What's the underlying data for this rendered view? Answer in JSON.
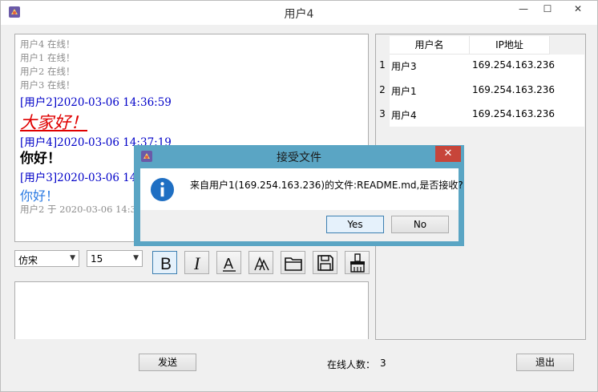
{
  "window": {
    "title": "用户4",
    "minimize_glyph": "—",
    "maximize_glyph": "☐",
    "close_glyph": "✕",
    "icon": "app-icon"
  },
  "chat": {
    "system_lines": [
      "用户4 在线！",
      "用户1 在线！",
      "用户2 在线！",
      "用户3 在线！"
    ],
    "messages": [
      {
        "header": "[用户2]2020-03-06 14:36:59",
        "text": "大家好！"
      },
      {
        "header": "[用户4]2020-03-06 14:37:19",
        "text": "你好！"
      },
      {
        "header": "[用户3]2020-03-06 14:37:34",
        "text": "你好！"
      }
    ],
    "last_line": "用户2 于 2020-03-06 14:38:10"
  },
  "toolbar": {
    "font_family": "仿宋",
    "font_size": "15",
    "icons": [
      "bold-icon",
      "italic-icon",
      "underline-icon",
      "color-icon",
      "folder-icon",
      "save-icon",
      "clear-icon"
    ],
    "bold_glyph": "B",
    "italic_glyph": "I",
    "underline_glyph": "A"
  },
  "bottom": {
    "send_label": "发送",
    "online_label": "在线人数：",
    "online_count": "3",
    "exit_label": "退出"
  },
  "users_table": {
    "headers": [
      "用户名",
      "IP地址"
    ],
    "rows": [
      {
        "num": "1",
        "name": "用户3",
        "ip": "169.254.163.236"
      },
      {
        "num": "2",
        "name": "用户1",
        "ip": "169.254.163.236"
      },
      {
        "num": "3",
        "name": "用户4",
        "ip": "169.254.163.236"
      }
    ]
  },
  "dialog": {
    "title": "接受文件",
    "close_glyph": "✕",
    "message": "来自用户1(169.254.163.236)的文件:README.md,是否接收?",
    "yes_label": "Yes",
    "no_label": "No",
    "icon": "info-icon"
  },
  "colors": {
    "header_blue": "#0000c8",
    "red_msg": "#e00000",
    "blue_msg": "#2a7ae2",
    "dialog_frame": "#5aa5c4",
    "close_red": "#c7453a"
  }
}
